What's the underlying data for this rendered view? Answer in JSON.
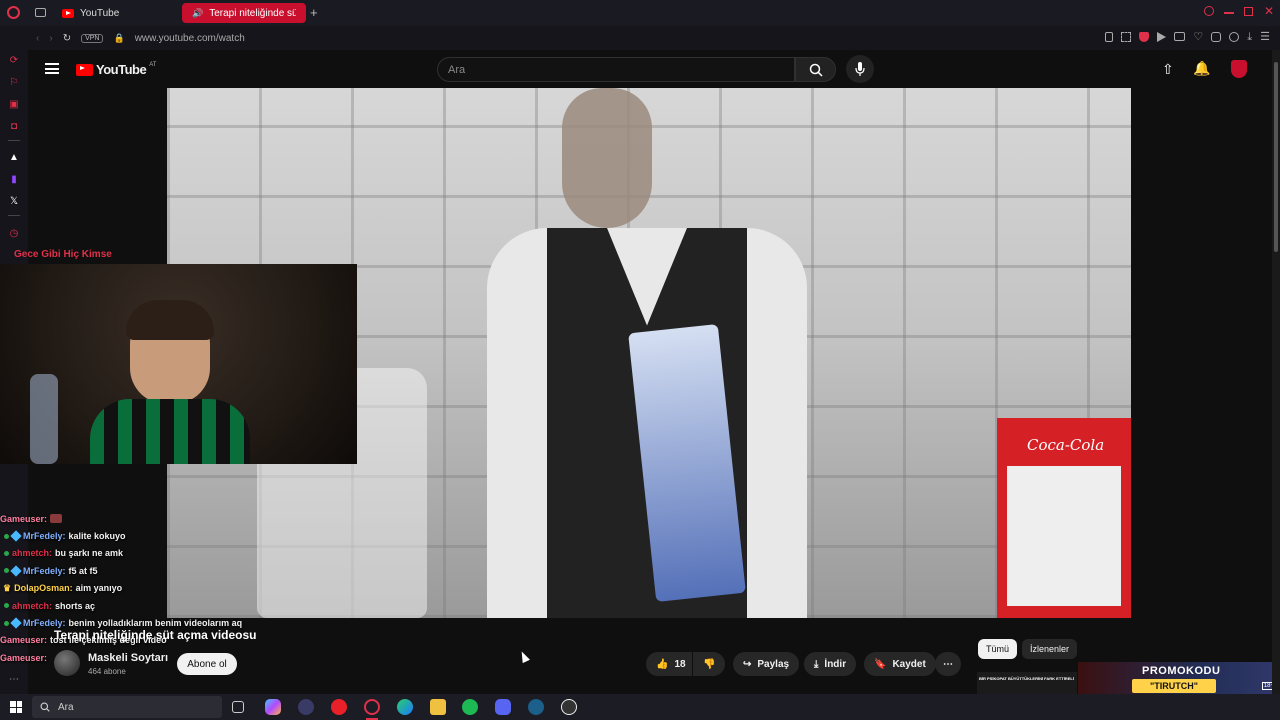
{
  "browser": {
    "tabs": [
      {
        "label": "YouTube"
      },
      {
        "label": "Terapi niteliğinde süt"
      }
    ],
    "url": "www.youtube.com/watch",
    "vpn_label": "VPN"
  },
  "youtube": {
    "logo_text": "YouTube",
    "region_code": "AT",
    "search_placeholder": "Ara"
  },
  "overlay": {
    "now_playing": "Gece Gibi Hiç Kimse"
  },
  "chat": [
    {
      "user": "Gameuser:",
      "message": "",
      "user_color": "#ff7fa0",
      "has_badge": false
    },
    {
      "user": "MrFedely:",
      "message": "kalite kokuyo",
      "user_color": "#7fb0ff",
      "has_badge": true
    },
    {
      "user": "ahmetch:",
      "message": "bu şarkı ne amk",
      "user_color": "#e0304a",
      "has_badge": true
    },
    {
      "user": "MrFedely:",
      "message": "f5 at f5",
      "user_color": "#7fb0ff",
      "has_badge": true
    },
    {
      "user": "DolapOsman:",
      "message": "aim yanıyo",
      "user_color": "#ffd24a",
      "has_badge": true
    },
    {
      "user": "ahmetch:",
      "message": "shorts aç",
      "user_color": "#e0304a",
      "has_badge": true
    },
    {
      "user": "MrFedely:",
      "message": "benim yolladıklarım benim videolarım aq",
      "user_color": "#7fb0ff",
      "has_badge": true
    },
    {
      "user": "Gameuser:",
      "message": "tost ile çekilmiş değil video",
      "user_color": "#ff7fa0",
      "has_badge": false
    },
    {
      "user": "Gameuser:",
      "message": "",
      "user_color": "#ff7fa0",
      "has_badge": false
    }
  ],
  "video": {
    "title": "Terapi niteliğinde süt açma videosu",
    "channel": "Maskeli Soytarı",
    "subscribers": "464 abone",
    "subscribe_label": "Abone ol",
    "likes": "18",
    "share_label": "Paylaş",
    "download_label": "İndir",
    "save_label": "Kaydet",
    "sign_text": "Coca-Cola"
  },
  "chips": [
    {
      "label": "Tümü",
      "active": true
    },
    {
      "label": "İzlenenler",
      "active": false
    }
  ],
  "ad": {
    "line1": "PROMOKODU",
    "line2": "\"TIRUTCH\"",
    "small_text": "BİR PSİKOPAT BÜYÜTTÜKLERİNİ FARK ETTİRELİ",
    "age": "18+"
  },
  "taskbar": {
    "search_placeholder": "Ara"
  },
  "colors": {
    "accent": "#c8102e",
    "youtube_red": "#ff0000",
    "background": "#0f0f0f"
  }
}
